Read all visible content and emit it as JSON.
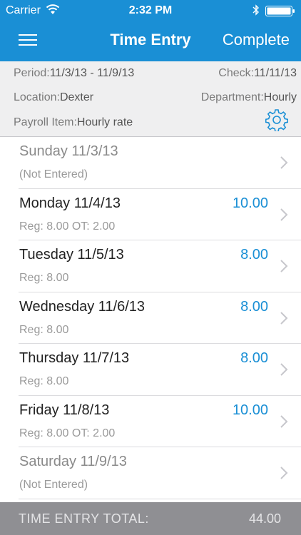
{
  "status_bar": {
    "carrier": "Carrier",
    "time": "2:32 PM"
  },
  "nav": {
    "title": "Time Entry",
    "complete_label": "Complete"
  },
  "info": {
    "period_label": "Period:",
    "period_value": "11/3/13 - 11/9/13",
    "check_label": "Check:",
    "check_value": "11/11/13",
    "location_label": "Location:",
    "location_value": "Dexter",
    "department_label": "Department:",
    "department_value": "Hourly",
    "payroll_label": "Payroll Item:",
    "payroll_value": "Hourly rate"
  },
  "days": [
    {
      "day": "Sunday 11/3/13",
      "detail": "(Not Entered)",
      "amount": ""
    },
    {
      "day": "Monday 11/4/13",
      "detail": "Reg: 8.00 OT: 2.00",
      "amount": "10.00"
    },
    {
      "day": "Tuesday 11/5/13",
      "detail": "Reg: 8.00",
      "amount": "8.00"
    },
    {
      "day": "Wednesday 11/6/13",
      "detail": "Reg: 8.00",
      "amount": "8.00"
    },
    {
      "day": "Thursday 11/7/13",
      "detail": "Reg: 8.00",
      "amount": "8.00"
    },
    {
      "day": "Friday 11/8/13",
      "detail": "Reg: 8.00 OT: 2.00",
      "amount": "10.00"
    },
    {
      "day": "Saturday 11/9/13",
      "detail": "(Not Entered)",
      "amount": ""
    }
  ],
  "footer": {
    "label": "TIME ENTRY TOTAL:",
    "total": "44.00"
  },
  "colors": {
    "accent": "#1a8fd5",
    "footer_bg": "#8f8f93",
    "info_bg": "#efeff0"
  }
}
